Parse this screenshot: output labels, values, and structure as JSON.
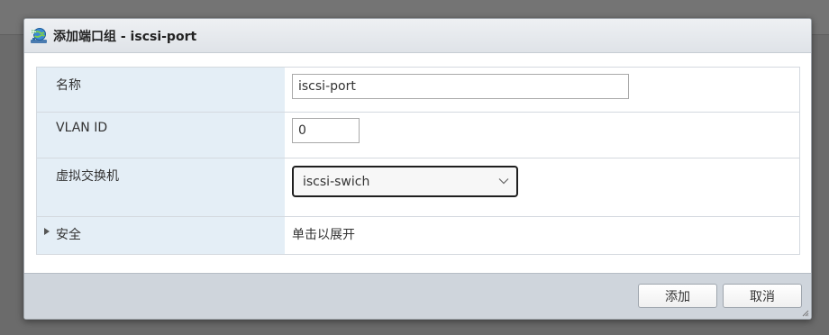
{
  "dialog": {
    "title": "添加端口组 - iscsi-port",
    "icon": "network-globe-icon"
  },
  "form": {
    "name_label": "名称",
    "name_value": "iscsi-port",
    "vlan_label": "VLAN ID",
    "vlan_value": "0",
    "vswitch_label": "虚拟交换机",
    "vswitch_value": "iscsi-swich",
    "security_label": "安全",
    "security_hint": "单击以展开"
  },
  "footer": {
    "add_label": "添加",
    "cancel_label": "取消"
  },
  "colors": {
    "label_bg": "#e4eef6",
    "footer_bg": "#cfd5dc",
    "titlebar_bg": "#e6e9ed"
  }
}
